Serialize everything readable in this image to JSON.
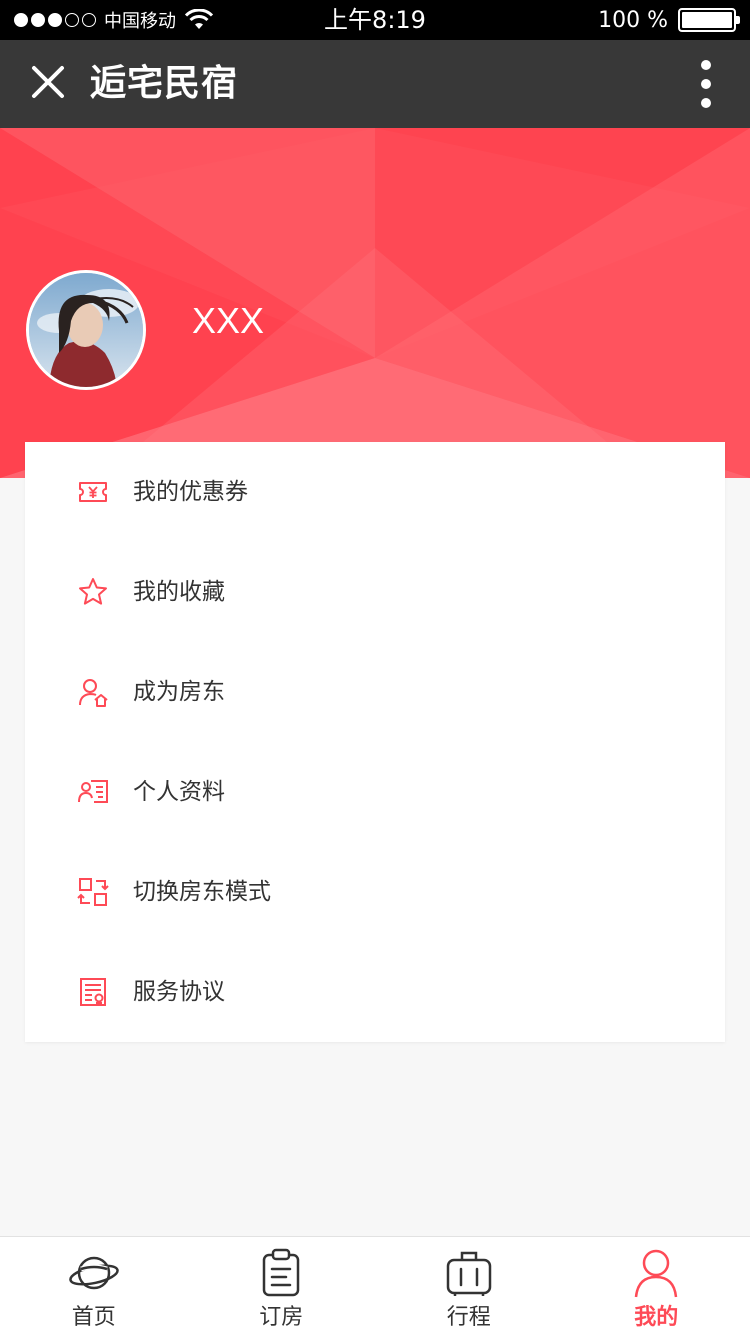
{
  "status_bar": {
    "carrier": "中国移动",
    "time": "上午8:19",
    "battery": "100 %",
    "signal_bars_filled": 3,
    "signal_bars_total": 5
  },
  "nav": {
    "title": "逅宅民宿",
    "close_icon": "close-icon",
    "more_icon": "more-vertical-icon"
  },
  "profile": {
    "username": "XXX"
  },
  "menu": {
    "items": [
      {
        "label": "我的优惠券",
        "icon": "coupon-icon"
      },
      {
        "label": "我的收藏",
        "icon": "star-icon"
      },
      {
        "label": "成为房东",
        "icon": "become-host-icon"
      },
      {
        "label": "个人资料",
        "icon": "profile-card-icon"
      },
      {
        "label": "切换房东模式",
        "icon": "switch-mode-icon"
      },
      {
        "label": "服务协议",
        "icon": "agreement-icon"
      }
    ]
  },
  "tabs": [
    {
      "label": "首页",
      "icon": "planet-icon",
      "active": false
    },
    {
      "label": "订房",
      "icon": "clipboard-icon",
      "active": false
    },
    {
      "label": "行程",
      "icon": "luggage-icon",
      "active": false
    },
    {
      "label": "我的",
      "icon": "user-icon",
      "active": true
    }
  ],
  "colors": {
    "accent": "#fe4a56",
    "nav_bg": "#383838",
    "status_bg": "#000000",
    "text": "#333333"
  }
}
